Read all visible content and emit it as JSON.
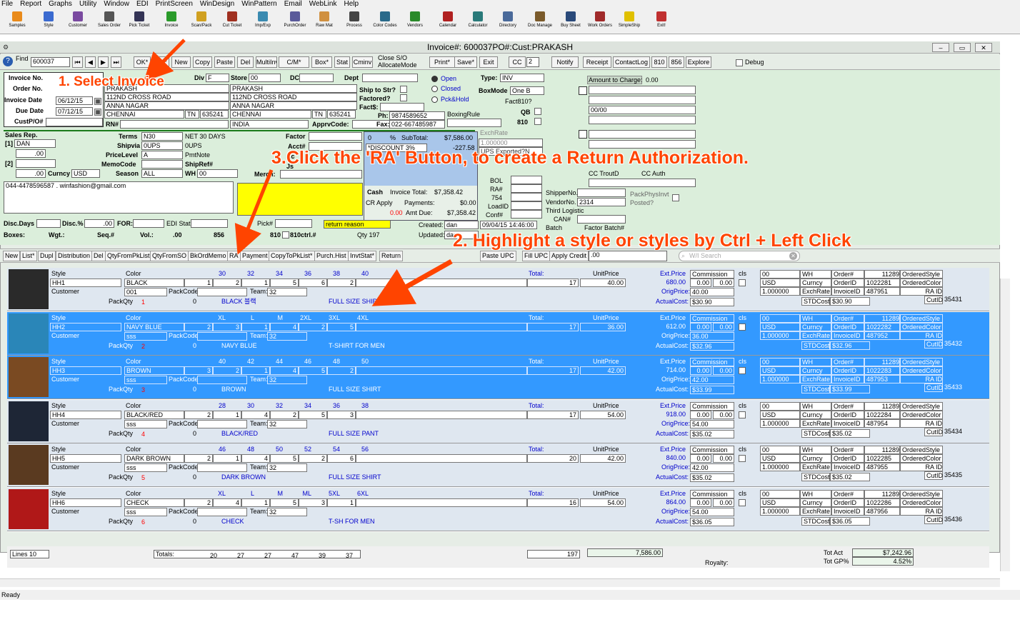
{
  "menu": [
    "File",
    "Report",
    "Graphs",
    "Utility",
    "Window",
    "EDI",
    "PrintScreen",
    "WinDesign",
    "WinPattern",
    "Email",
    "WebLink",
    "Help"
  ],
  "toolbar": [
    "Samples",
    "Style",
    "Customer",
    "Sales Order",
    "Pick Ticket",
    "Invoice",
    "Scan/Pack",
    "Cut Ticket",
    "Imp/Exp",
    "PurchOrder",
    "Raw Mat",
    "Process",
    "Color Codes",
    "Vendors",
    "Calendar",
    "Calculator",
    "Directory",
    "Doc Manage",
    "Buy Sheet",
    "Work Orders",
    "SimpleShip",
    "Exit!"
  ],
  "window": {
    "title": "Invoice#: 600037PO#:Cust:PRAKASH"
  },
  "nav": {
    "find_label": "Find",
    "find_value": "600037",
    "buttons": [
      "OK*",
      "List*",
      "New",
      "Copy",
      "Paste",
      "Del",
      "MultiInv*",
      "C/M*",
      "Box*",
      "Stat",
      "Cminv"
    ],
    "close_so": "Close S/O",
    "allocate": "AllocateMode",
    "print": "Print*",
    "save": "Save*",
    "exit": "Exit",
    "cc": "CC",
    "cc_value": "2",
    "notify": "Notify",
    "receipt": "Receipt",
    "contactlog": "ContactLog",
    "b810": "810",
    "b856": "856",
    "explore": "Explore",
    "debug": "Debug"
  },
  "header": {
    "invoice_no_label": "Invoice No.",
    "invoice_no": "600037",
    "order_no_label": "Order No.",
    "invoice_date_label": "Invoice Date",
    "invoice_date": "06/12/15",
    "due_date_label": "Due Date",
    "due_date": "07/12/15",
    "custpo_label": "CustP/O#",
    "div": "Div",
    "div_value": "F",
    "store": "Store",
    "store_value": "00",
    "dc": "DC",
    "dept": "Dept",
    "billto": [
      "PRAKASH",
      "112ND CROSS ROAD",
      "ANNA NAGAR",
      "CHENNAI"
    ],
    "bill_state": "TN",
    "bill_zip": "635241",
    "shipto": [
      "PRAKASH",
      "112ND CROSS ROAD",
      "ANNA NAGAR",
      "CHENNAI"
    ],
    "ship_state": "TN",
    "ship_zip": "635241",
    "ship_country": "INDIA",
    "rn": "RN#",
    "apprv": "ApprvCode:",
    "ship_to_str": "Ship to Str?",
    "factored": "Factored?",
    "fact": "Fact$:",
    "ph": "Ph:",
    "ph_value": "9874589652",
    "fax": "Fax:",
    "fax_value": "022-667485987",
    "boxing": "BoxingRule",
    "open": "Open",
    "closed": "Closed",
    "pckhold": "Pck&Hold",
    "type": "Type:",
    "type_value": "INV",
    "boxmode": "BoxMode",
    "boxmode_value": "One B",
    "fact810": "Fact810?",
    "qb": "QB",
    "e810": "810",
    "amount_charge": "Amount to Charge:",
    "amount_value": "0.00",
    "date00": "00/00",
    "salesrep": "Sales Rep.",
    "rep1": "[1]",
    "rep1_value": "DAN",
    "rep_pct": ".00",
    "rep2": "[2]",
    "rep_pct2": ".00",
    "curncy": "Curncy",
    "curncy_value": "USD",
    "terms": "Terms",
    "terms_value": "N30",
    "terms_desc": "NET 30 DAYS",
    "shipvia": "Shipvia",
    "shipvia_value": "0UPS",
    "shipvia_desc": "0UPS",
    "pricelevel": "PriceLevel",
    "pricelevel_value": "A",
    "pmtnote": "PmtNote",
    "memocode": "MemoCode",
    "shipref": "ShipRef#",
    "season": "Season",
    "season_value": "ALL",
    "wh": "WH",
    "wh_value": "00",
    "merch": "Merch:",
    "factor": "Factor",
    "acct": "Acct#",
    "ac": "Ac",
    "js": "Js",
    "contact": "044-4478596587 . winfashion@gmail.com",
    "pct0": "0",
    "pct": "%",
    "subtotal": "SubTotal:",
    "subtotal_value": "$7,586.00",
    "discount": "*DISCOUNT 3%",
    "discount_value": "-227.58",
    "cash": "Cash",
    "inv_total": "Invoice Total:",
    "inv_total_value": "$7,358.42",
    "crapply": "CR Apply",
    "payments": "Payments:",
    "payments_value": "$0.00",
    "cr_value": "0.00",
    "amt_due": "Amt Due:",
    "amt_due_value": "$7,358.42",
    "exchrate": "ExchRate",
    "exch_value": "1.000000",
    "ups_exported": "UPS Exported?N",
    "bol": "BOL",
    "ra": "RA#",
    "ra_value": "754",
    "loadid": "LoadID",
    "conf": "Conf#",
    "shipperno": "ShipperNo.",
    "vendorno": "VendorNo.",
    "vendorno_value": "2314",
    "thirdlog": "Third Logistic",
    "can": "CAN#",
    "batch": "Batch",
    "factor_batch": "Factor Batch#",
    "cctroutd": "CC TroutD",
    "ccauth": "CC Auth",
    "packphys": "PackPhysInvt",
    "posted": "Posted?",
    "disc_days": "Disc.Days",
    "disc_pct": "Disc.%",
    "disc_pct_value": ".00",
    "for": "FOR:",
    "edi_stat": "EDI Stat",
    "pick": "Pick#",
    "return_reason": "return reason",
    "boxes": "Boxes:",
    "wgt": "Wgt.:",
    "seq": "Seq.#",
    "vol": "Vol.:",
    "vol_value": ".00",
    "v856": "856",
    "v810": "810",
    "ctrl": "810ctrl.#",
    "qty": "Qty 197",
    "created": "Created:",
    "created_by": "dan",
    "created_at": "09/04/15 14:46:00",
    "updated": "Updated:",
    "updated_by": "dan"
  },
  "tabs": [
    "New",
    "List*",
    "Dupl",
    "Distribution",
    "Del",
    "QtyFromPkList",
    "QtyFromSO",
    "BkOrdMemo",
    "RA",
    "Payment",
    "CopyToPkList*",
    "Purch.Hist",
    "InvtStat*",
    "Return",
    "Paste UPC",
    "Fill UPC",
    "Apply Credit"
  ],
  "tabs_credit_value": ".00",
  "tabs_search": "W/I Search",
  "row_labels": {
    "style": "Style",
    "color": "Color",
    "customer": "Customer",
    "packcode": "PackCode",
    "packqty": "PackQty",
    "team": "Team:",
    "total": "Total:",
    "unitprice": "UnitPrice",
    "extprice": "Ext.Price",
    "commission": "Commission",
    "cls": "cls",
    "origprice": "OrigPrice:",
    "actualcost": "ActualCost:",
    "wh": "WH",
    "curncy": "Curncy",
    "exchrate": "ExchRate",
    "order": "Order#",
    "orderid": "OrderID",
    "invoiceid": "InvoiceID",
    "orderedstyle": "OrderedStyle",
    "orderedcolor": "OrderedColor",
    "raid": "RA ID",
    "stdcost": "STDCost",
    "cutid": "CutID"
  },
  "rows": [
    {
      "style": "HH1",
      "color": "BLACK",
      "customer": "001",
      "sizes": [
        "30",
        "32",
        "34",
        "36",
        "38",
        "40"
      ],
      "qtys": [
        "1",
        "2",
        "1",
        "5",
        "6",
        "2"
      ],
      "total": "17",
      "unit": "40.00",
      "ext": "680.00",
      "comm1": "0.00",
      "comm2": "0.00",
      "orig": "40.00",
      "actual": "$30.90",
      "wh": "00",
      "cur": "USD",
      "exch": "1.000000",
      "ord": "11289",
      "ordid": "1022281",
      "invid": "487951",
      "std": "$30.90",
      "cut": "35431",
      "packqty": "1",
      "team": "32",
      "pq0": "0",
      "colordesc": "BLACK 블랙",
      "desc": "FULL SIZE SHIRT",
      "hl": false,
      "photo": "#2a2a2a"
    },
    {
      "style": "HH2",
      "color": "NAVY BLUE",
      "customer": "sss",
      "sizes": [
        "XL",
        "L",
        "M",
        "2XL",
        "3XL",
        "4XL"
      ],
      "qtys": [
        "2",
        "3",
        "1",
        "4",
        "2",
        "5"
      ],
      "total": "17",
      "unit": "36.00",
      "ext": "612.00",
      "comm1": "0.00",
      "comm2": "0.00",
      "orig": "36.00",
      "actual": "$32.96",
      "wh": "00",
      "cur": "USD",
      "exch": "1.000000",
      "ord": "11289",
      "ordid": "1022282",
      "invid": "487952",
      "std": "$32.96",
      "cut": "35432",
      "packqty": "2",
      "team": "32",
      "pq0": "0",
      "colordesc": "NAVY BLUE",
      "desc": "T-SHIRT FOR MEN",
      "hl": true,
      "photo": "#2a86b8"
    },
    {
      "style": "HH3",
      "color": "BROWN",
      "customer": "sss",
      "sizes": [
        "40",
        "42",
        "44",
        "46",
        "48",
        "50"
      ],
      "qtys": [
        "3",
        "2",
        "1",
        "4",
        "5",
        "2"
      ],
      "total": "17",
      "unit": "42.00",
      "ext": "714.00",
      "comm1": "0.00",
      "comm2": "0.00",
      "orig": "42.00",
      "actual": "$33.99",
      "wh": "00",
      "cur": "USD",
      "exch": "1.000000",
      "ord": "11289",
      "ordid": "1022283",
      "invid": "487953",
      "std": "$33.99",
      "cut": "35433",
      "packqty": "3",
      "team": "32",
      "pq0": "0",
      "colordesc": "BROWN",
      "desc": "FULL SIZE SHIRT",
      "hl": true,
      "photo": "#7a4a22"
    },
    {
      "style": "HH4",
      "color": "BLACK/RED",
      "customer": "sss",
      "sizes": [
        "28",
        "30",
        "32",
        "34",
        "36",
        "38"
      ],
      "qtys": [
        "2",
        "1",
        "4",
        "2",
        "5",
        "3"
      ],
      "total": "17",
      "unit": "54.00",
      "ext": "918.00",
      "comm1": "0.00",
      "comm2": "0.00",
      "orig": "54.00",
      "actual": "$35.02",
      "wh": "00",
      "cur": "USD",
      "exch": "1.000000",
      "ord": "11289",
      "ordid": "1022284",
      "invid": "487954",
      "std": "$35.02",
      "cut": "35434",
      "packqty": "4",
      "team": "32",
      "pq0": "0",
      "colordesc": "BLACK/RED",
      "desc": "FULL SIZE PANT",
      "hl": false,
      "photo": "#1e2636"
    },
    {
      "style": "HH5",
      "color": "DARK BROWN",
      "customer": "sss",
      "sizes": [
        "46",
        "48",
        "50",
        "52",
        "54",
        "56"
      ],
      "qtys": [
        "2",
        "1",
        "4",
        "5",
        "2",
        "6"
      ],
      "total": "20",
      "unit": "42.00",
      "ext": "840.00",
      "comm1": "0.00",
      "comm2": "0.00",
      "orig": "42.00",
      "actual": "$35.02",
      "wh": "00",
      "cur": "USD",
      "exch": "1.000000",
      "ord": "11289",
      "ordid": "1022285",
      "invid": "487955",
      "std": "$35.02",
      "cut": "35435",
      "packqty": "5",
      "team": "32",
      "pq0": "0",
      "colordesc": "DARK BROWN",
      "desc": "FULL SIZE SHIRT",
      "hl": false,
      "photo": "#5a3a20"
    },
    {
      "style": "HH6",
      "color": "CHECK",
      "customer": "sss",
      "sizes": [
        "XL",
        "L",
        "M",
        "ML",
        "5XL",
        "6XL"
      ],
      "qtys": [
        "2",
        "4",
        "1",
        "5",
        "3",
        "1"
      ],
      "total": "16",
      "unit": "54.00",
      "ext": "864.00",
      "comm1": "0.00",
      "comm2": "0.00",
      "orig": "54.00",
      "actual": "$36.05",
      "wh": "00",
      "cur": "USD",
      "exch": "1.000000",
      "ord": "11289",
      "ordid": "1022286",
      "invid": "487956",
      "std": "$36.05",
      "cut": "35436",
      "packqty": "6",
      "team": "32",
      "pq0": "0",
      "colordesc": "CHECK",
      "desc": "T-SH FOR MEN",
      "hl": false,
      "photo": "#b01818"
    }
  ],
  "footer": {
    "lines": "Lines",
    "lines_value": "10",
    "totals": "Totals:",
    "sizes": [
      "20",
      "27",
      "27",
      "47",
      "39",
      "37"
    ],
    "grand": "197",
    "amount": "7,586.00",
    "royalty": "Royalty:",
    "totact": "Tot Act",
    "totact_value": "$7,242.96",
    "totgp": "Tot GP%",
    "totgp_value": "4.52%"
  },
  "status": "Ready",
  "callouts": {
    "c1": "1. Select Invoice",
    "c2": "2. Highlight a style or styles by Ctrl + Left Click",
    "c3": "3.Click the 'RA' Button, to create a Return Authorization."
  }
}
